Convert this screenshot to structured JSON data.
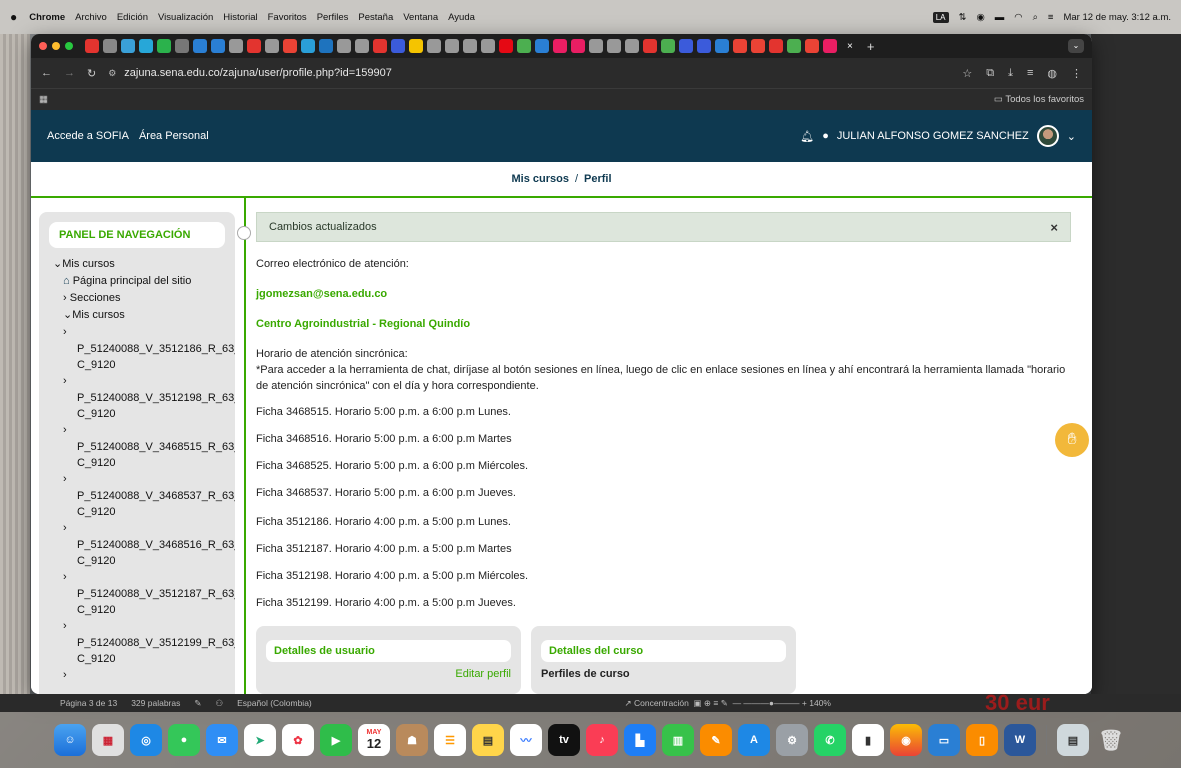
{
  "macmenu": {
    "app": "Chrome",
    "items": [
      "Archivo",
      "Edición",
      "Visualización",
      "Historial",
      "Favoritos",
      "Perfiles",
      "Pestaña",
      "Ventana",
      "Ayuda"
    ],
    "input_badge": "LA",
    "datetime": "Mar 12 de may.  3:12 a.m."
  },
  "browser": {
    "url": "zajuna.sena.edu.co/zajuna/user/profile.php?id=159907",
    "favorites": "Todos los favoritos"
  },
  "site": {
    "link1": "Accede a SOFIA",
    "link2": "Área Personal",
    "user_name": "JULIAN ALFONSO GOMEZ SANCHEZ"
  },
  "breadcrumb": {
    "part1": "Mis cursos",
    "sep": "/",
    "part2": "Perfil"
  },
  "nav": {
    "title": "PANEL DE NAVEGACIÓN",
    "root": "Mis cursos",
    "home": "Página principal del sitio",
    "sections": "Secciones",
    "my_courses": "Mis cursos",
    "courses": [
      "P_51240088_V_3512186_R_63_C_9120",
      "P_51240088_V_3512198_R_63_C_9120",
      "P_51240088_V_3468515_R_63_C_9120",
      "P_51240088_V_3468537_R_63_C_9120",
      "P_51240088_V_3468516_R_63_C_9120",
      "P_51240088_V_3512187_R_63_C_9120",
      "P_51240088_V_3512199_R_63_C_9120"
    ]
  },
  "alert": {
    "text": "Cambios actualizados",
    "close": "×"
  },
  "main": {
    "contact_label": "Correo electrónico de atención:",
    "email": "jgomezsan@sena.edu.co",
    "center": "Centro Agroindustrial - Regional Quindío",
    "schedule_title": "Horario de atención sincrónica:",
    "schedule_desc": "*Para acceder a la herramienta de chat, diríjase al botón sesiones en línea, luego de clic en enlace sesiones en línea y ahí encontrará la herramienta llamada \"horario de atención sincrónica\" con el día y hora correspondiente.",
    "fichas": [
      "Ficha 3468515. Horario 5:00 p.m. a 6:00 p.m Lunes.",
      "Ficha 3468516. Horario 5:00 p.m. a 6:00 p.m Martes",
      "Ficha 3468525. Horario 5:00 p.m. a 6:00 p.m Miércoles.",
      "Ficha 3468537. Horario 5:00 p.m. a 6:00 p.m Jueves.",
      "Ficha 3512186. Horario 4:00 p.m. a 5:00 p.m Lunes.",
      "Ficha 3512187. Horario 4:00 p.m. a 5:00 p.m Martes",
      "Ficha 3512198. Horario 4:00 p.m. a 5:00 p.m Miércoles.",
      "Ficha 3512199. Horario 4:00 p.m. a 5:00 p.m Jueves."
    ]
  },
  "cards": {
    "user_title": "Detalles de usuario",
    "edit_profile": "Editar perfil",
    "course_title": "Detalles del curso",
    "course_profiles": "Perfiles de curso"
  },
  "wordbar": {
    "page": "Página 3 de 13",
    "words": "329 palabras",
    "lang": "Español (Colombia)",
    "focus": "Concentración",
    "zoom": "140%"
  },
  "background": {
    "price": "30 eur"
  },
  "dock": {
    "calendar_month": "MAY",
    "calendar_day": "12",
    "tv": "tv"
  }
}
